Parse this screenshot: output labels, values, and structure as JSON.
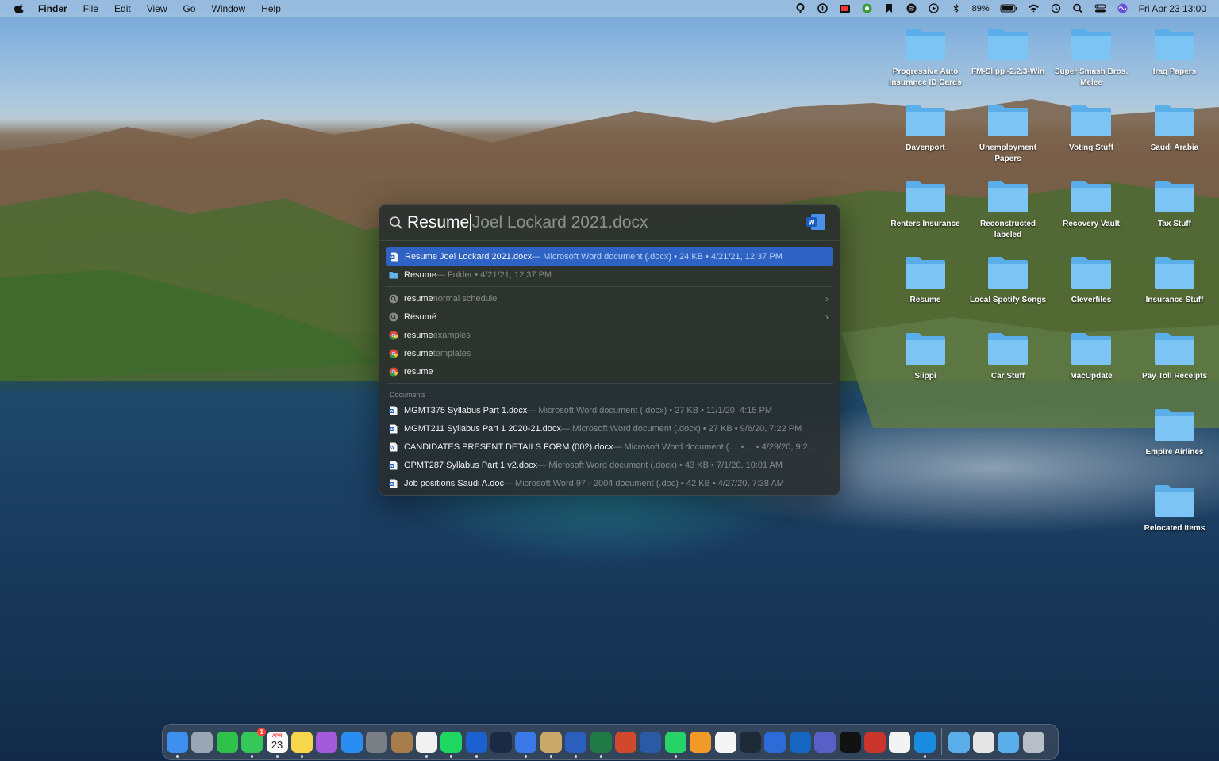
{
  "menubar": {
    "app_name": "Finder",
    "menus": [
      "File",
      "Edit",
      "View",
      "Go",
      "Window",
      "Help"
    ],
    "battery": "89%",
    "datetime": "Fri Apr 23  13:00",
    "status_icons": [
      "p-icon",
      "1password-icon",
      "photo-booth-icon",
      "chrome-icon",
      "bookmark-icon",
      "spotify-icon",
      "play-icon",
      "bluetooth-icon",
      "battery-icon",
      "wifi-icon",
      "time-machine-icon",
      "spotlight-icon",
      "control-center-icon",
      "siri-icon"
    ]
  },
  "spotlight": {
    "typed": "Resume",
    "completion": "Joel Lockard 2021.docx",
    "top_hits": [
      {
        "name": "Resume Joel Lockard 2021.docx",
        "detail": " — Microsoft Word document (.docx) • 24 KB • 4/21/21, 12:37 PM",
        "icon": "word-doc-icon",
        "selected": true
      },
      {
        "name": "Resume",
        "detail": " — Folder • 4/21/21, 12:37 PM",
        "icon": "folder-icon",
        "selected": false
      }
    ],
    "suggestions": [
      {
        "main": "resume",
        "rest": " normal schedule",
        "icon": "search-suggestion-icon",
        "chevron": true
      },
      {
        "main": "Résumé",
        "rest": "",
        "icon": "search-suggestion-icon",
        "chevron": true
      },
      {
        "main": "resume",
        "rest": " examples",
        "icon": "chrome-icon",
        "chevron": false
      },
      {
        "main": "resume",
        "rest": " templates",
        "icon": "chrome-icon",
        "chevron": false
      },
      {
        "main": "resume",
        "rest": "",
        "icon": "chrome-icon",
        "chevron": false
      }
    ],
    "documents_title": "Documents",
    "documents": [
      {
        "name": "MGMT375 Syllabus Part 1.docx",
        "detail": " — Microsoft Word document (.docx) • 27 KB • 11/1/20, 4:15 PM"
      },
      {
        "name": "MGMT211 Syllabus Part 1 2020-21.docx",
        "detail": " — Microsoft Word document (.docx) • 27 KB • 9/6/20, 7:22 PM"
      },
      {
        "name": "CANDIDATES PRESENT DETAILS FORM (002).docx",
        "detail": " — Microsoft Word document (.... • ... • 4/29/20, 9:2..."
      },
      {
        "name": "GPMT287 Syllabus Part 1 v2.docx",
        "detail": " — Microsoft Word document (.docx) • 43 KB • 7/1/20, 10:01 AM"
      },
      {
        "name": "Job positions Saudi  A.doc",
        "detail": " — Microsoft Word 97 - 2004 document (.doc) • 42 KB • 4/27/20, 7:38 AM"
      }
    ]
  },
  "desktop_folders": [
    "Progressive Auto Insurance ID Cards",
    "FM-Slippi-2.2.3-Win",
    "Super Smash Bros. Melee",
    "Iraq Papers",
    "Davenport",
    "Unemployment Papers",
    "Voting Stuff",
    "Saudi Arabia",
    "Renters Insurance",
    "Reconstructed labeled",
    "Recovery Vault",
    "Tax Stuff",
    "Resume",
    "Local Spotify Songs",
    "Cleverfiles",
    "Insurance Stuff",
    "Slippi",
    "Car Stuff",
    "MacUpdate",
    "Pay Toll Receipts",
    "Empire Airlines",
    "Relocated Items"
  ],
  "dock": {
    "calendar_month": "APR",
    "calendar_day": "23",
    "messages_badge": "1",
    "apps": [
      "finder-icon",
      "launchpad-icon",
      "facetime-icon",
      "messages-icon",
      "calendar-icon",
      "notes-icon",
      "podcasts-icon",
      "app-store-icon",
      "system-preferences-icon",
      "archive-icon",
      "chrome-icon",
      "spotify-icon",
      "1password-icon",
      "steam-icon",
      "tasks-icon",
      "preview-icon",
      "word-icon",
      "excel-icon",
      "powerpoint-icon",
      "macos-icon",
      "whatsapp-icon",
      "books-icon",
      "photos-icon",
      "kindle-icon",
      "xcode-icon",
      "outlook-icon",
      "teams-icon",
      "apple-tv-icon",
      "parallels-icon",
      "slack-icon",
      "skype-icon",
      "downloads-folder-icon",
      "documents-stack-icon",
      "applications-folder-icon",
      "trash-icon"
    ]
  }
}
